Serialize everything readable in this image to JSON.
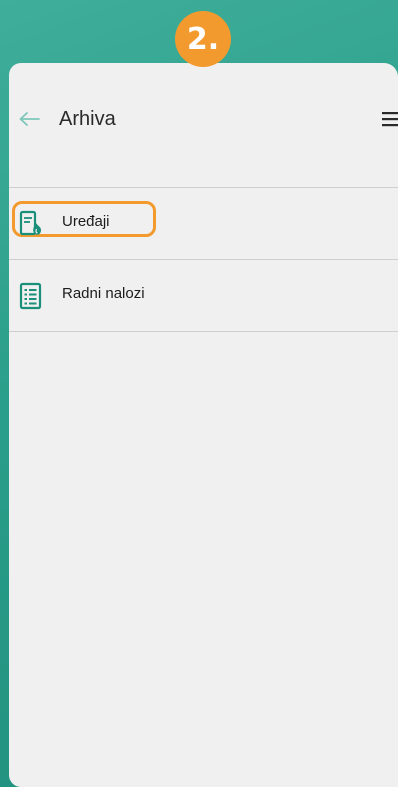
{
  "step_badge": "2.",
  "header": {
    "title": "Arhiva",
    "back_icon": "arrow-left-icon",
    "menu_icon": "hamburger-menu-icon"
  },
  "menu": {
    "items": [
      {
        "label": "Uređaji",
        "icon": "device-document-icon",
        "highlighted": true
      },
      {
        "label": "Radni nalozi",
        "icon": "work-order-list-icon",
        "highlighted": false
      }
    ]
  },
  "colors": {
    "accent": "#1f8f7c",
    "highlight": "#f39a2e",
    "background": "#f0f0f0"
  }
}
